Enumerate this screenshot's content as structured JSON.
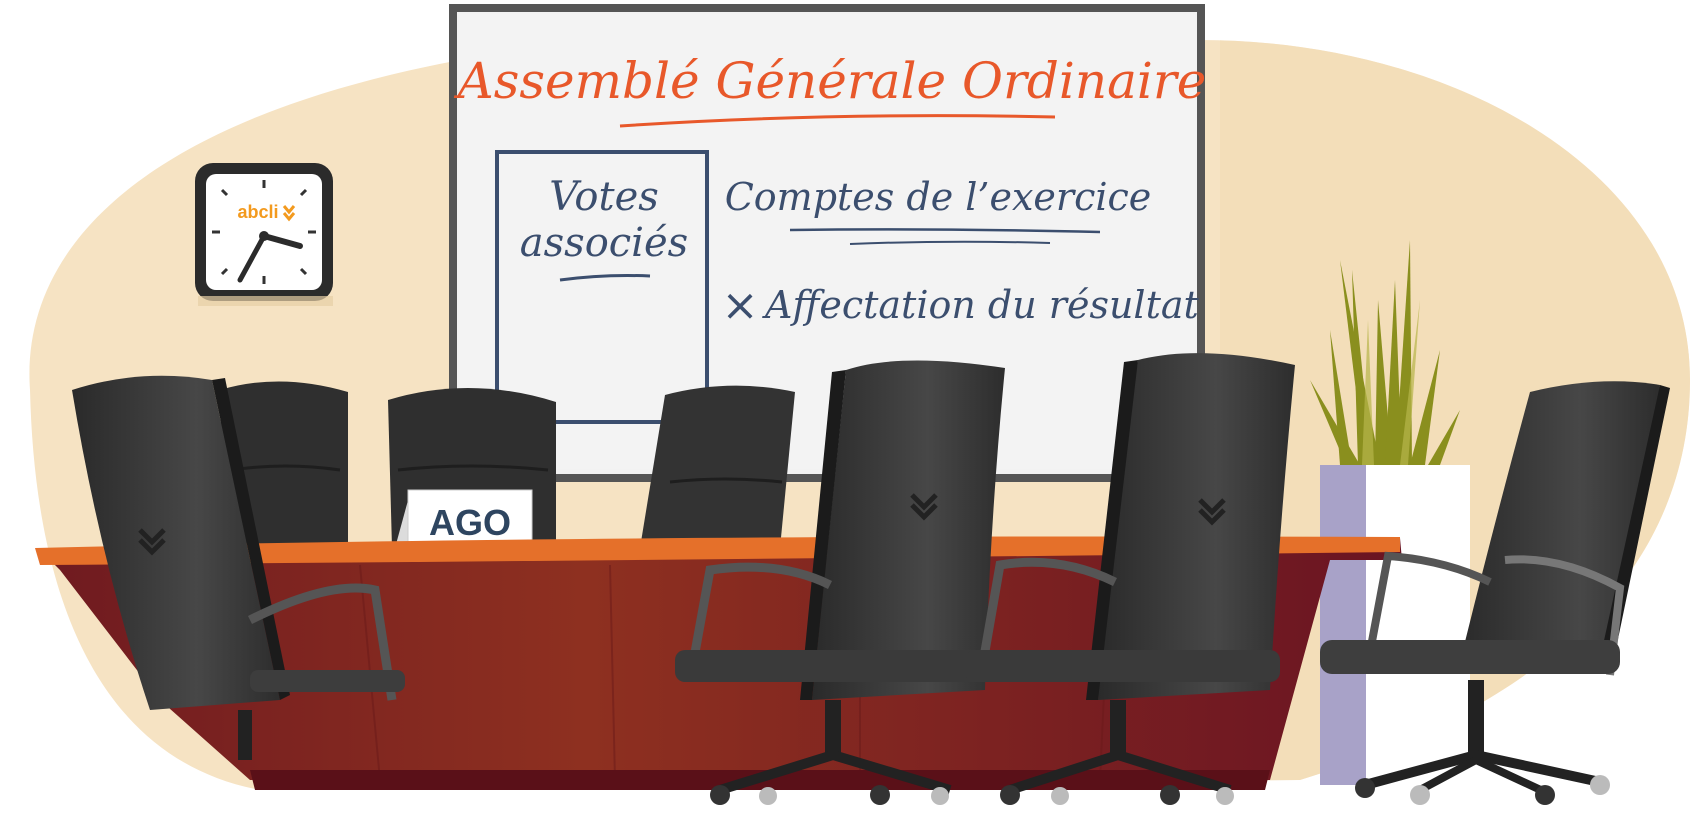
{
  "whiteboard": {
    "title": "Assemblé Générale Ordinaire",
    "box_line1": "Votes",
    "box_line2": "associés",
    "item1": "Comptes de l’exercice",
    "item2_mark": "×",
    "item2": "Affectation du résultat"
  },
  "clock": {
    "brand": "abcli"
  },
  "name_card": {
    "label": "AGO"
  },
  "colors": {
    "wall": "#f6e3c3",
    "board_text_orange": "#e8582a",
    "board_text_blue": "#3b4e6e",
    "table_top": "#e5702a",
    "table_body": "#8a2424",
    "chair": "#3a3a3a",
    "planter": "#a8a2c8",
    "plant": "#8a8f1e",
    "brand_orange": "#f39a1e"
  },
  "icons": [
    "clock-icon",
    "chevron-logo-icon",
    "cross-mark-icon"
  ]
}
